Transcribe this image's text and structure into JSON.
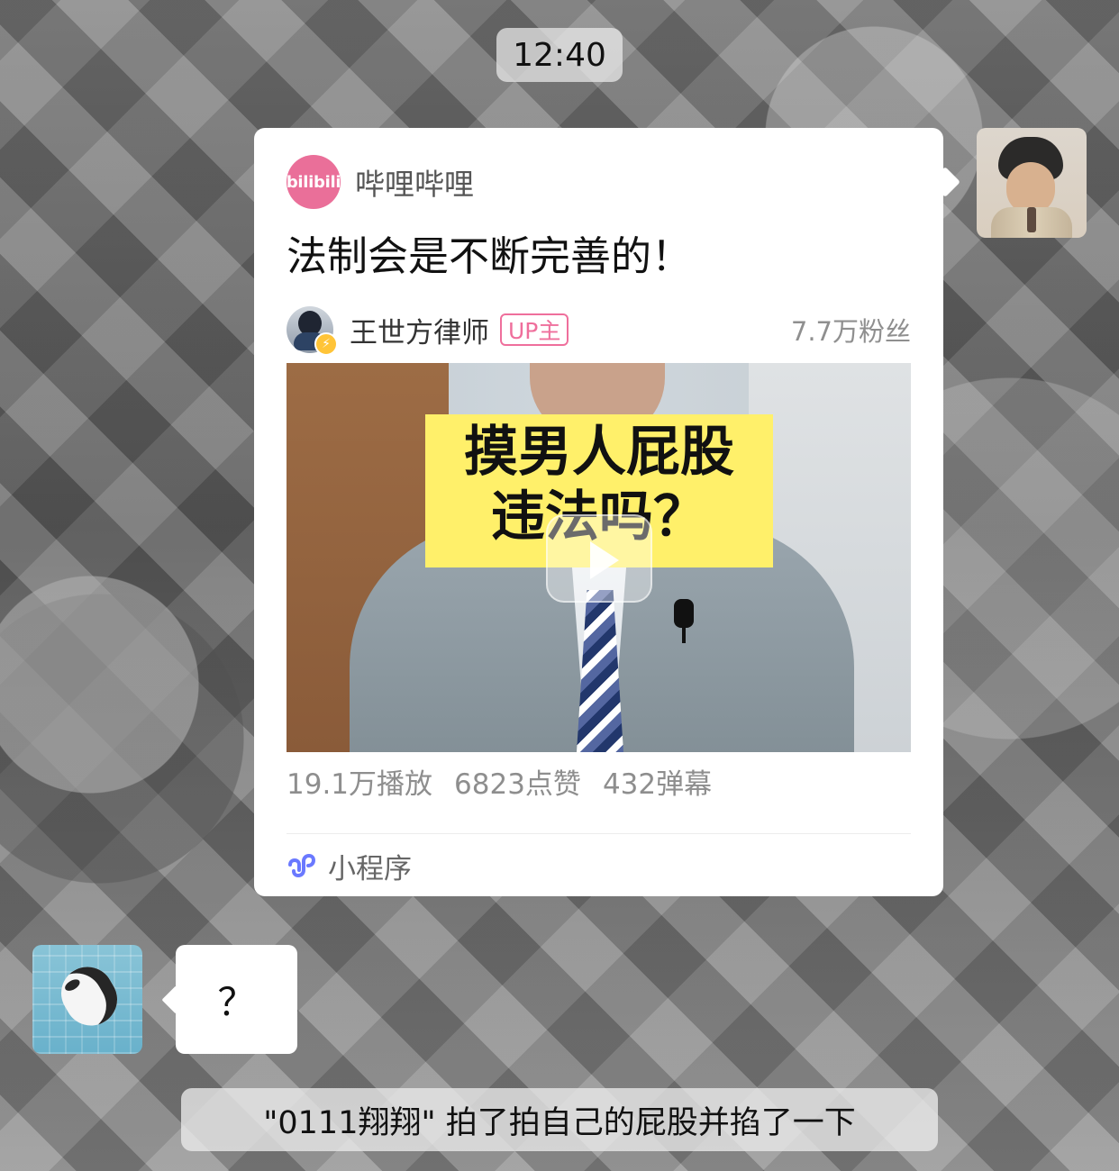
{
  "status": {
    "time": "12:40"
  },
  "share_card": {
    "app_name": "哔哩哔哩",
    "logo_text": "bilibili",
    "title": "法制会是不断完善的！",
    "author": {
      "name": "王世方律师",
      "badge": "UP主",
      "fans": "7.7万粉丝"
    },
    "thumbnail": {
      "caption_line1": "摸男人屁股",
      "caption_line2": "违法吗？"
    },
    "stats": [
      "19.1万播放",
      "6823点赞",
      "432弹幕"
    ],
    "mini_program": {
      "label": "小程序"
    }
  },
  "left_message": {
    "text": "？"
  },
  "system_message": {
    "text": "\"0111翔翔\" 拍了拍自己的屁股并掐了一下"
  },
  "colors": {
    "bilibili_pink": "#ea6f99",
    "up_badge": "#ef6f9c",
    "mini_program_blue": "#6a79ff"
  },
  "icons": {
    "verified": "lightning-icon",
    "play": "play-icon",
    "mini_program": "mini-program-icon"
  }
}
